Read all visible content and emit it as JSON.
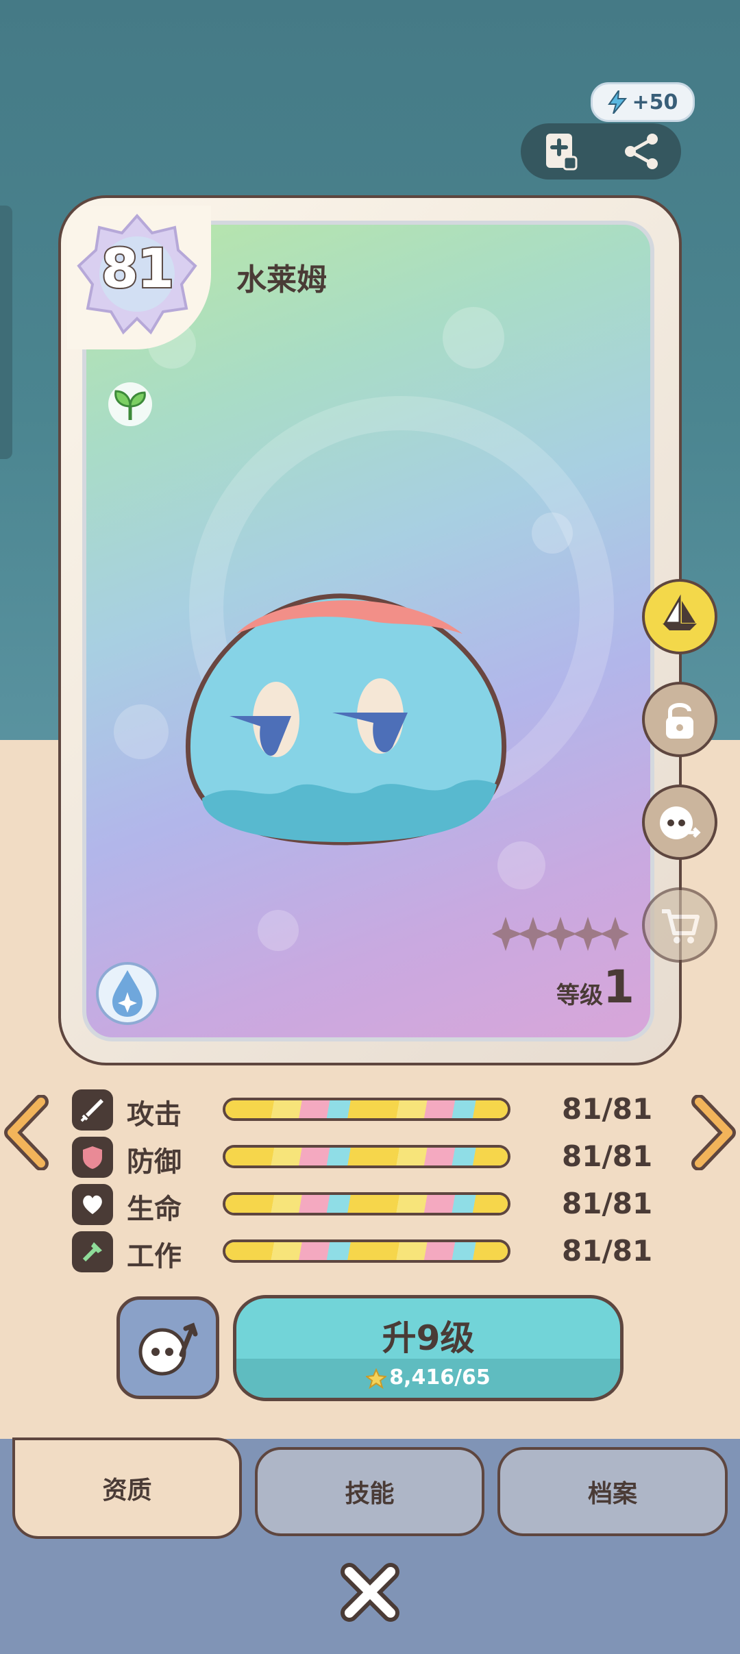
{
  "header": {
    "energy_bonus": "+50"
  },
  "card": {
    "level_badge": "81",
    "name": "水莱姆",
    "level_label": "等级",
    "level_value": "1",
    "star_count": 5,
    "element": "water-element-icon"
  },
  "stats": [
    {
      "name": "攻击",
      "value": "81/81",
      "icon": "sword-icon",
      "fill": 1.0
    },
    {
      "name": "防御",
      "value": "81/81",
      "icon": "shield-icon",
      "fill": 1.0
    },
    {
      "name": "生命",
      "value": "81/81",
      "icon": "heart-icon",
      "fill": 1.0
    },
    {
      "name": "工作",
      "value": "81/81",
      "icon": "work-tool-icon",
      "fill": 1.0
    }
  ],
  "upgrade": {
    "label": "升9级",
    "cost": "8,416/65"
  },
  "tabs": {
    "aptitude": "资质",
    "skills": "技能",
    "profile": "档案"
  },
  "colors": {
    "accent_teal": "#72d4d8",
    "outline_brown": "#5e463f",
    "sand": "#f1dcc4"
  }
}
